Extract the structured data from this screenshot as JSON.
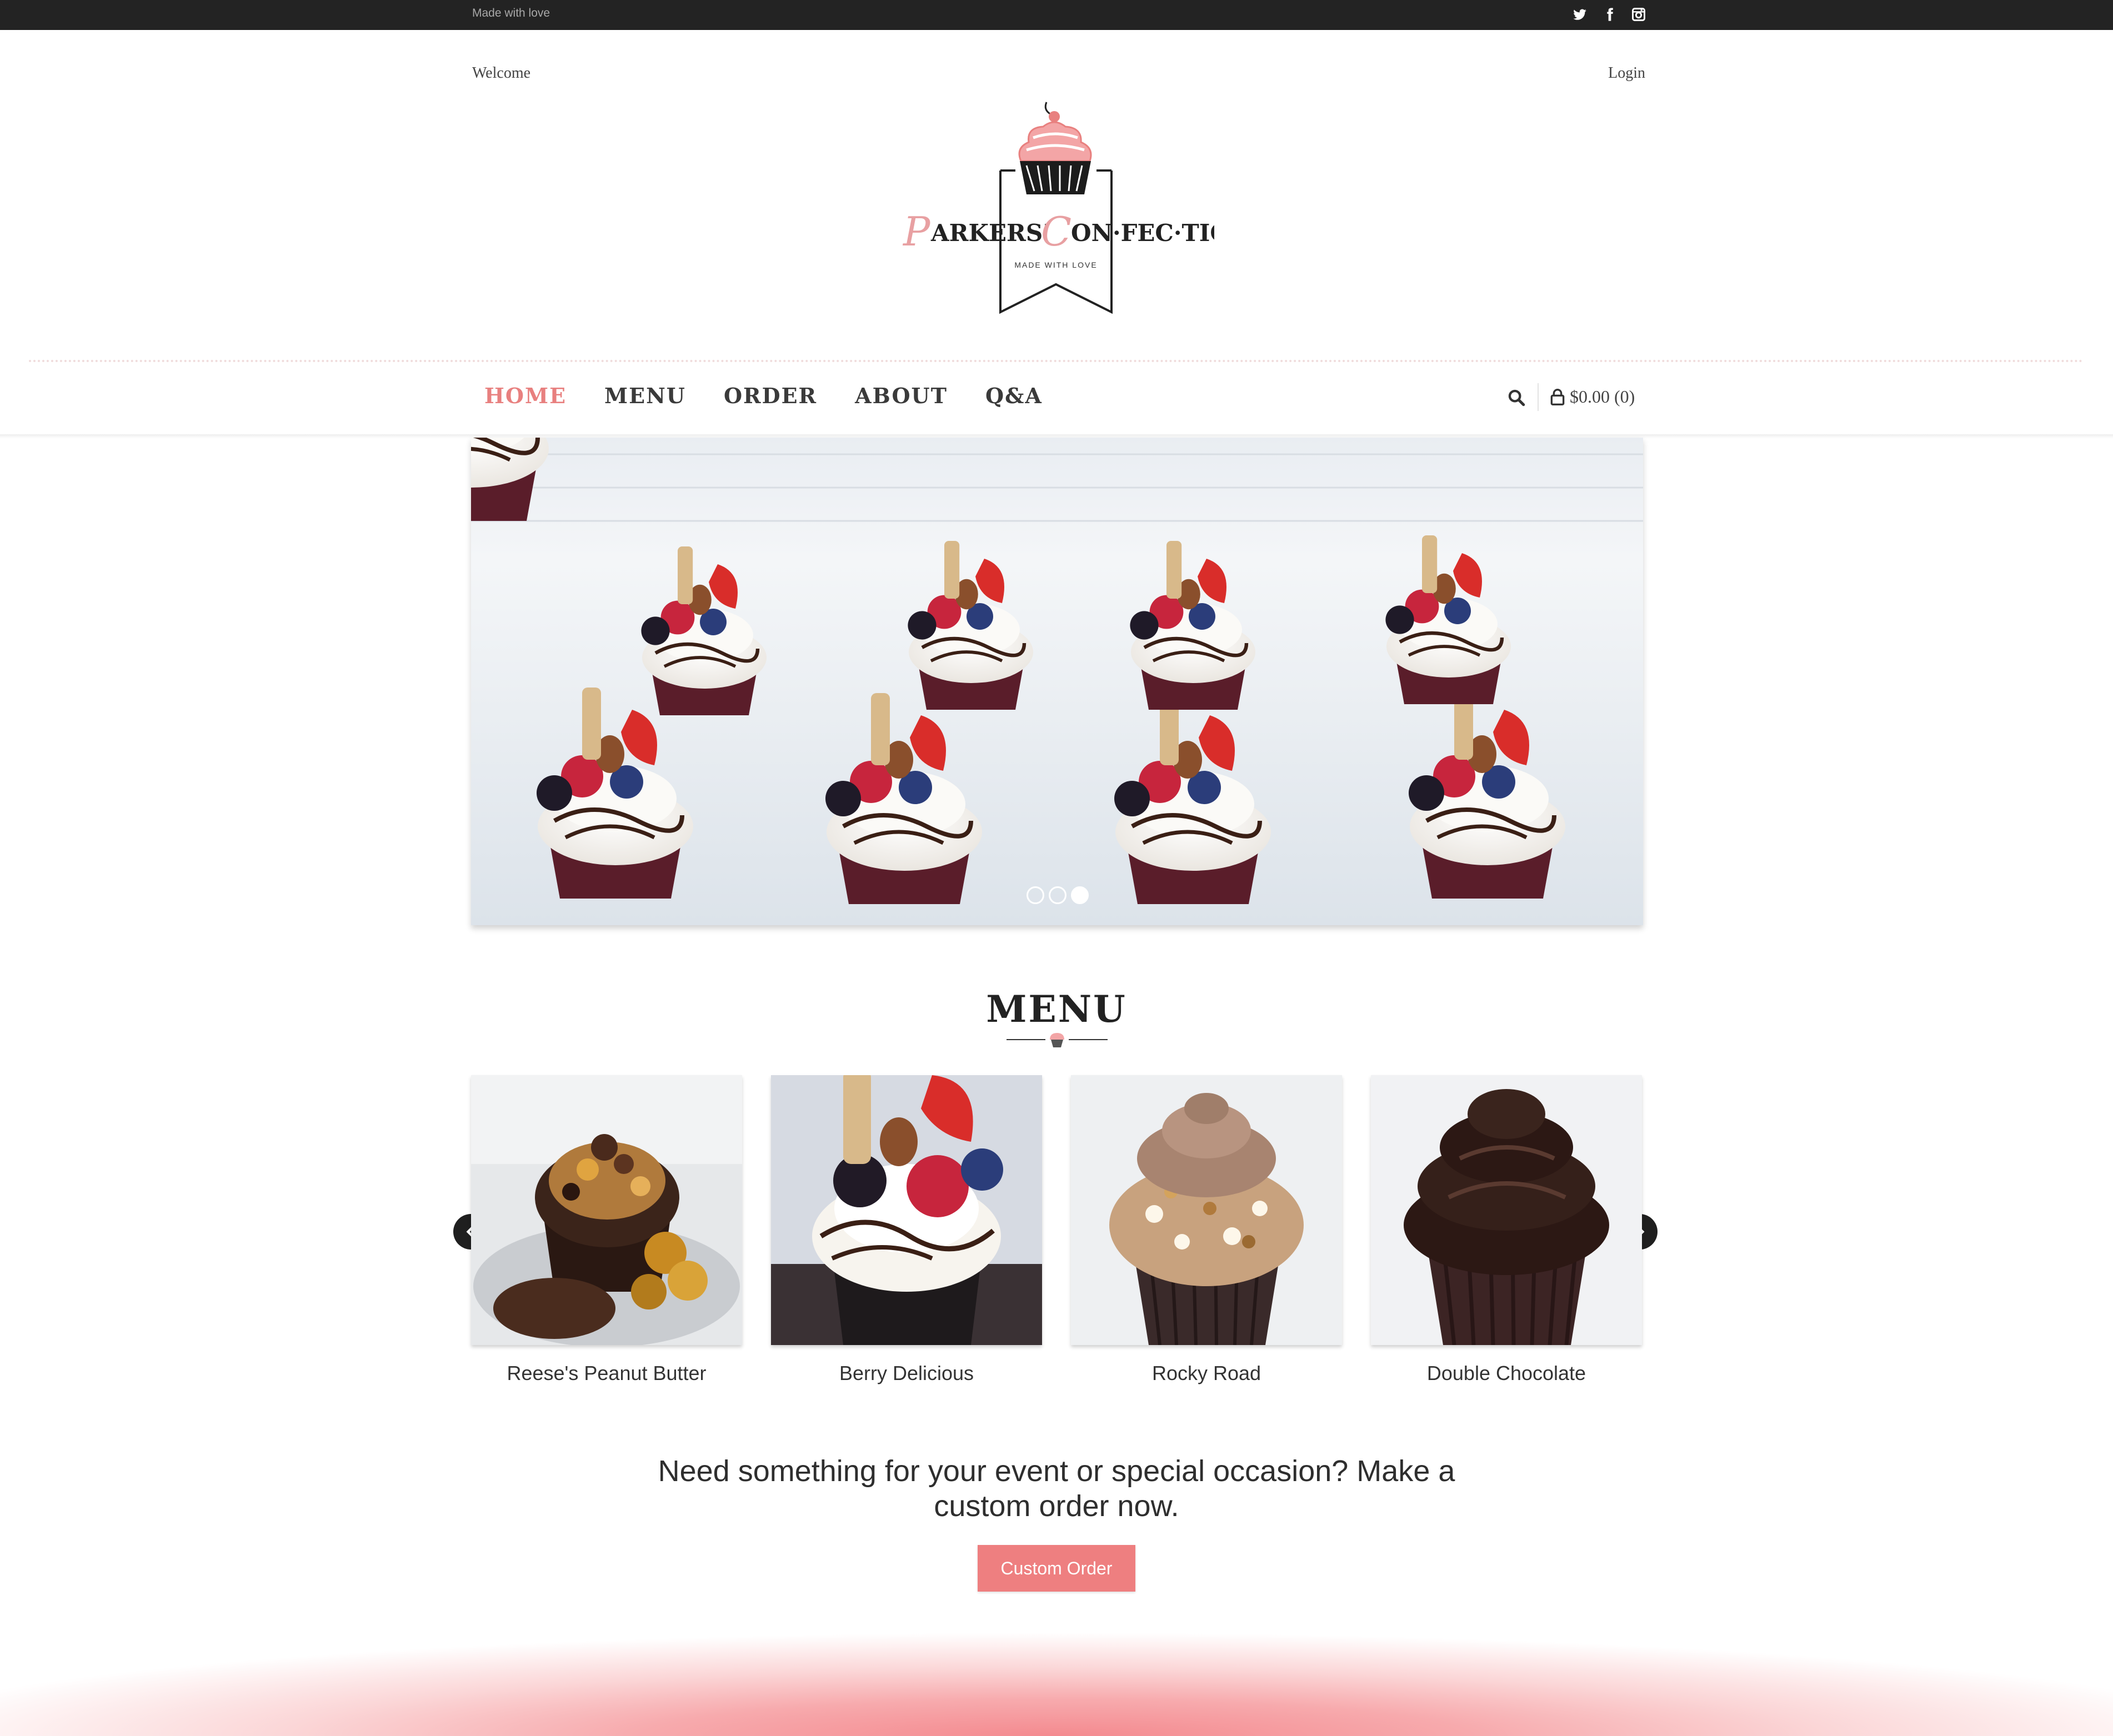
{
  "topbar": {
    "tagline": "Made with love",
    "social": [
      "twitter-icon",
      "facebook-icon",
      "instagram-icon"
    ]
  },
  "header": {
    "welcome": "Welcome",
    "login": "Login"
  },
  "logo": {
    "brand_word_1": "ARKERS'",
    "brand_initial_1": "P",
    "brand_word_2": "ON·FEC·TION",
    "brand_initial_2": "C",
    "motto": "MADE WITH LOVE"
  },
  "nav": {
    "items": [
      {
        "label": "HOME",
        "active": true
      },
      {
        "label": "MENU",
        "active": false
      },
      {
        "label": "ORDER",
        "active": false
      },
      {
        "label": "ABOUT",
        "active": false
      },
      {
        "label": "Q&A",
        "active": false
      }
    ],
    "cart_label": "$0.00 (0)"
  },
  "hero": {
    "slide_count": 3,
    "active_slide": 3
  },
  "menu_section": {
    "title": "MENU",
    "products": [
      {
        "name": "Reese's Peanut Butter"
      },
      {
        "name": "Berry Delicious"
      },
      {
        "name": "Rocky Road"
      },
      {
        "name": "Double Chocolate"
      }
    ]
  },
  "cta": {
    "text": "Need something for your event or special occasion? Make a custom order now.",
    "button": "Custom Order"
  },
  "colors": {
    "accent": "#ee7f80",
    "topbar": "#232323",
    "nav_active": "#e8807f"
  }
}
